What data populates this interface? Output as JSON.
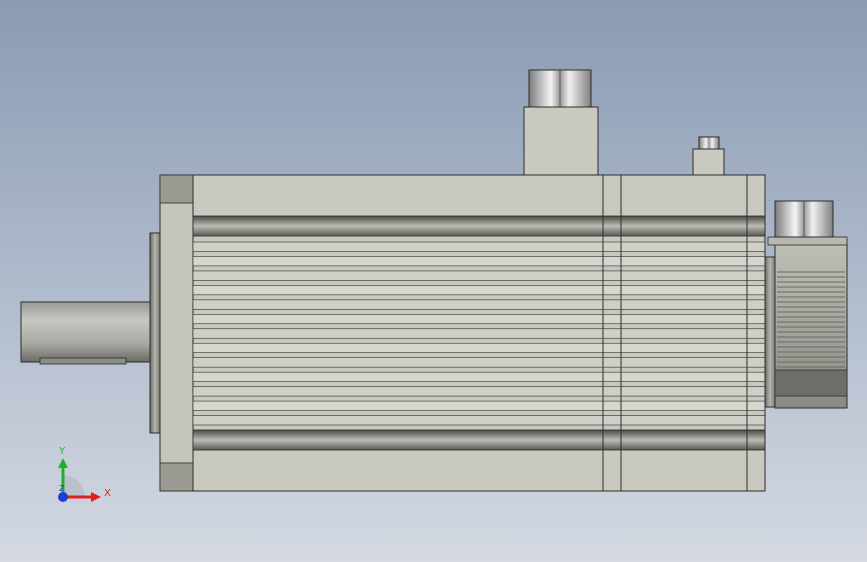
{
  "viewport": {
    "background_top": "#8a9bb4",
    "background_bottom": "#d4d9e2"
  },
  "model": {
    "name_icon": "servo-motor-side-view",
    "colors": {
      "body_light": "#c9c9bf",
      "body_mid": "#a9a9a0",
      "body_dark": "#6e6e68",
      "edge": "#2c2c2c",
      "metal_light": "#f2f2f2",
      "metal_dark": "#8c8c8c"
    }
  },
  "triad": {
    "x_label": "X",
    "y_label": "Y",
    "z_label": "Z",
    "x_color": "#e02020",
    "y_color": "#20b030",
    "z_color": "#1c3fd6"
  }
}
